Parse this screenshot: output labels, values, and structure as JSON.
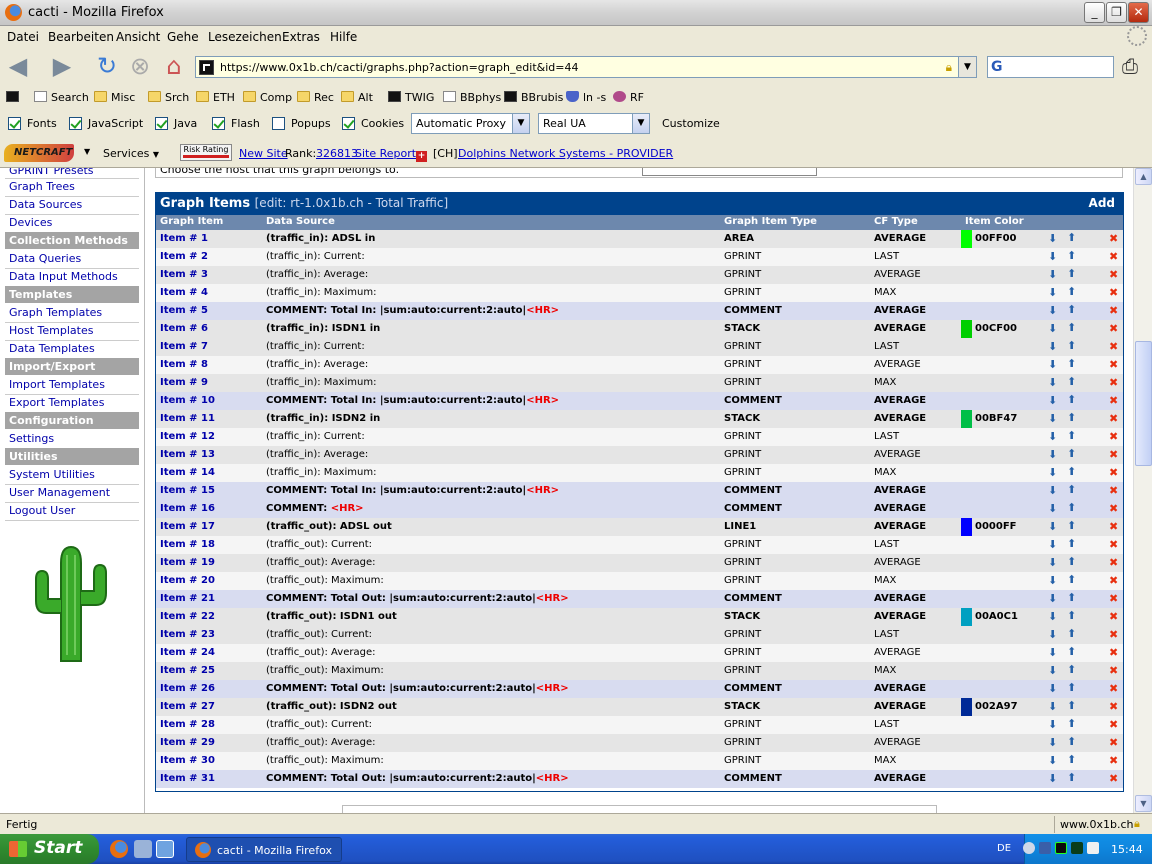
{
  "window": {
    "title": "cacti - Mozilla Firefox"
  },
  "menu": [
    "Datei",
    "Bearbeiten",
    "Ansicht",
    "Gehe",
    "Lesezeichen",
    "Extras",
    "Hilfe"
  ],
  "url": "https://www.0x1b.ch/cacti/graphs.php?action=graph_edit&id=44",
  "bookmarks": [
    {
      "label": "Search",
      "icon": "page-icon"
    },
    {
      "label": "Misc",
      "icon": "folder-icon"
    },
    {
      "label": "Srch",
      "icon": "folder-icon"
    },
    {
      "label": "ETH",
      "icon": "folder-icon"
    },
    {
      "label": "Comp",
      "icon": "folder-icon"
    },
    {
      "label": "Rec",
      "icon": "folder-icon"
    },
    {
      "label": "Alt",
      "icon": "folder-icon"
    },
    {
      "label": "TWIG",
      "icon": "black-site-icon"
    },
    {
      "label": "BBphys",
      "icon": "page-icon"
    },
    {
      "label": "BBrubis",
      "icon": "black-site-icon"
    },
    {
      "label": "ln -s",
      "icon": "shield-icon"
    },
    {
      "label": "RF",
      "icon": "pink-icon"
    }
  ],
  "prefbar": {
    "checks": [
      {
        "label": "Fonts",
        "checked": true
      },
      {
        "label": "JavaScript",
        "checked": true
      },
      {
        "label": "Java",
        "checked": true
      },
      {
        "label": "Flash",
        "checked": true
      },
      {
        "label": "Popups",
        "checked": false
      },
      {
        "label": "Cookies",
        "checked": true
      }
    ],
    "proxy": "Automatic Proxy",
    "ua": "Real UA",
    "customize": "Customize"
  },
  "netcraft": {
    "logo": "NETCRAFT",
    "services": "Services",
    "risk": "Risk Rating",
    "new_site": "New Site",
    "rank_label": "Rank:",
    "rank": "326813",
    "report": "Site Report",
    "country": "[CH]",
    "host": "Dolphins Network Systems - PROVIDER"
  },
  "sidebar": {
    "top_cut": "GPRINT Presets",
    "links1": [
      "Graph Trees",
      "Data Sources",
      "Devices"
    ],
    "h_collection": "Collection Methods",
    "links2": [
      "Data Queries",
      "Data Input Methods"
    ],
    "h_templates": "Templates",
    "links3": [
      "Graph Templates",
      "Host Templates",
      "Data Templates"
    ],
    "h_import": "Import/Export",
    "links4": [
      "Import Templates",
      "Export Templates"
    ],
    "h_config": "Configuration",
    "links5": [
      "Settings"
    ],
    "h_util": "Utilities",
    "links6": [
      "System Utilities",
      "User Management",
      "Logout User"
    ]
  },
  "prev_text": "Choose the host that this graph belongs to.",
  "graph_items": {
    "title": "Graph Items",
    "subtitle": "[edit: rt-1.0x1b.ch - Total Traffic]",
    "add": "Add",
    "columns": [
      "Graph Item",
      "Data Source",
      "Graph Item Type",
      "CF Type",
      "Item Color"
    ],
    "rows": [
      {
        "item": "Item # 1",
        "src": "(traffic_in): ADSL in",
        "type": "AREA",
        "cf": "AVERAGE",
        "color": "00FF00",
        "sw": "#00ff00",
        "bold": true
      },
      {
        "item": "Item # 2",
        "src": "(traffic_in): Current:",
        "type": "GPRINT",
        "cf": "LAST"
      },
      {
        "item": "Item # 3",
        "src": "(traffic_in): Average:",
        "type": "GPRINT",
        "cf": "AVERAGE"
      },
      {
        "item": "Item # 4",
        "src": "(traffic_in): Maximum:",
        "type": "GPRINT",
        "cf": "MAX"
      },
      {
        "item": "Item # 5",
        "src": "COMMENT: Total In: |sum:auto:current:2:auto|",
        "hr": "<HR>",
        "type": "COMMENT",
        "cf": "AVERAGE",
        "bold": true
      },
      {
        "item": "Item # 6",
        "src": "(traffic_in): ISDN1 in",
        "type": "STACK",
        "cf": "AVERAGE",
        "color": "00CF00",
        "sw": "#00cf00",
        "bold": true
      },
      {
        "item": "Item # 7",
        "src": "(traffic_in): Current:",
        "type": "GPRINT",
        "cf": "LAST"
      },
      {
        "item": "Item # 8",
        "src": "(traffic_in): Average:",
        "type": "GPRINT",
        "cf": "AVERAGE"
      },
      {
        "item": "Item # 9",
        "src": "(traffic_in): Maximum:",
        "type": "GPRINT",
        "cf": "MAX"
      },
      {
        "item": "Item # 10",
        "src": "COMMENT: Total In: |sum:auto:current:2:auto|",
        "hr": "<HR>",
        "type": "COMMENT",
        "cf": "AVERAGE",
        "bold": true
      },
      {
        "item": "Item # 11",
        "src": "(traffic_in): ISDN2 in",
        "type": "STACK",
        "cf": "AVERAGE",
        "color": "00BF47",
        "sw": "#00bf47",
        "bold": true
      },
      {
        "item": "Item # 12",
        "src": "(traffic_in): Current:",
        "type": "GPRINT",
        "cf": "LAST"
      },
      {
        "item": "Item # 13",
        "src": "(traffic_in): Average:",
        "type": "GPRINT",
        "cf": "AVERAGE"
      },
      {
        "item": "Item # 14",
        "src": "(traffic_in): Maximum:",
        "type": "GPRINT",
        "cf": "MAX"
      },
      {
        "item": "Item # 15",
        "src": "COMMENT: Total In: |sum:auto:current:2:auto|",
        "hr": "<HR>",
        "type": "COMMENT",
        "cf": "AVERAGE",
        "bold": true
      },
      {
        "item": "Item # 16",
        "src": "COMMENT: ",
        "hr": "<HR>",
        "type": "COMMENT",
        "cf": "AVERAGE",
        "bold": true
      },
      {
        "item": "Item # 17",
        "src": "(traffic_out): ADSL out",
        "type": "LINE1",
        "cf": "AVERAGE",
        "color": "0000FF",
        "sw": "#0000ff",
        "bold": true
      },
      {
        "item": "Item # 18",
        "src": "(traffic_out): Current:",
        "type": "GPRINT",
        "cf": "LAST"
      },
      {
        "item": "Item # 19",
        "src": "(traffic_out): Average:",
        "type": "GPRINT",
        "cf": "AVERAGE"
      },
      {
        "item": "Item # 20",
        "src": "(traffic_out): Maximum:",
        "type": "GPRINT",
        "cf": "MAX"
      },
      {
        "item": "Item # 21",
        "src": "COMMENT: Total Out: |sum:auto:current:2:auto|",
        "hr": "<HR>",
        "type": "COMMENT",
        "cf": "AVERAGE",
        "bold": true
      },
      {
        "item": "Item # 22",
        "src": "(traffic_out): ISDN1 out",
        "type": "STACK",
        "cf": "AVERAGE",
        "color": "00A0C1",
        "sw": "#00a0c1",
        "bold": true
      },
      {
        "item": "Item # 23",
        "src": "(traffic_out): Current:",
        "type": "GPRINT",
        "cf": "LAST"
      },
      {
        "item": "Item # 24",
        "src": "(traffic_out): Average:",
        "type": "GPRINT",
        "cf": "AVERAGE"
      },
      {
        "item": "Item # 25",
        "src": "(traffic_out): Maximum:",
        "type": "GPRINT",
        "cf": "MAX"
      },
      {
        "item": "Item # 26",
        "src": "COMMENT: Total Out: |sum:auto:current:2:auto|",
        "hr": "<HR>",
        "type": "COMMENT",
        "cf": "AVERAGE",
        "bold": true
      },
      {
        "item": "Item # 27",
        "src": "(traffic_out): ISDN2 out",
        "type": "STACK",
        "cf": "AVERAGE",
        "color": "002A97",
        "sw": "#002a97",
        "bold": true
      },
      {
        "item": "Item # 28",
        "src": "(traffic_out): Current:",
        "type": "GPRINT",
        "cf": "LAST"
      },
      {
        "item": "Item # 29",
        "src": "(traffic_out): Average:",
        "type": "GPRINT",
        "cf": "AVERAGE"
      },
      {
        "item": "Item # 30",
        "src": "(traffic_out): Maximum:",
        "type": "GPRINT",
        "cf": "MAX"
      },
      {
        "item": "Item # 31",
        "src": "COMMENT: Total Out: |sum:auto:current:2:auto|",
        "hr": "<HR>",
        "type": "COMMENT",
        "cf": "AVERAGE",
        "bold": true
      }
    ]
  },
  "status": {
    "left": "Fertig",
    "host": "www.0x1b.ch"
  },
  "taskbar": {
    "start": "Start",
    "task": "cacti - Mozilla Firefox",
    "lang": "DE",
    "time": "15:44"
  }
}
